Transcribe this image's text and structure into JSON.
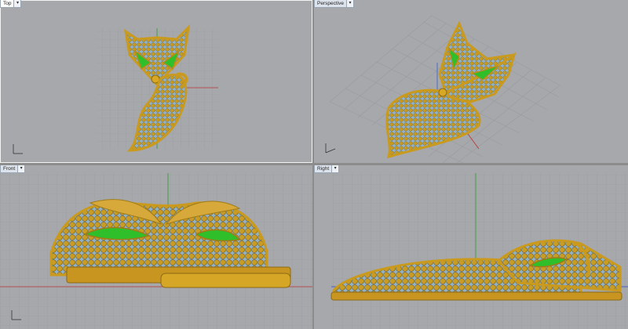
{
  "app": {
    "accent": "#c9a227",
    "gem_color": "#2fbf2a",
    "grid_color": "#9b9ea2"
  },
  "viewports": [
    {
      "id": "top",
      "label": "Top",
      "active": true
    },
    {
      "id": "perspective",
      "label": "Perspective",
      "active": false
    },
    {
      "id": "front",
      "label": "Front",
      "active": false
    },
    {
      "id": "right",
      "label": "Right",
      "active": false
    }
  ],
  "dropdown_glyph": "▾"
}
